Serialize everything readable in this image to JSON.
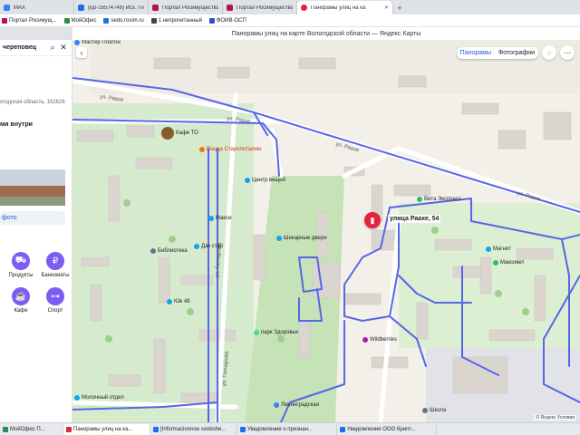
{
  "tabs": [
    {
      "label": "MAX",
      "color": "#3b82f6"
    },
    {
      "label": "(Бр-16574749) Исх. Письм",
      "color": "#1f6feb"
    },
    {
      "label": "Портал Росимущества",
      "color": "#b3125b"
    },
    {
      "label": "Портал Росимущества",
      "color": "#b3125b"
    },
    {
      "label": "Панорамы улиц на ка",
      "color": "#e5243b"
    }
  ],
  "new_tab": "+",
  "bookmarks": [
    {
      "label": "Портал Росимущ...",
      "color": "#b3125b"
    },
    {
      "label": "МойОфис",
      "color": "#2a8f4a"
    },
    {
      "label": "sedo.rosim.ru",
      "color": "#1f6feb"
    },
    {
      "label": "1 непрочитанный",
      "color": "#444"
    },
    {
      "label": "ФОИВ-ОСП",
      "color": "#2456c4"
    }
  ],
  "page_title": "Панорамы улиц на карте Вологодской области — Яндекс Карты",
  "panel": {
    "search_text": "череповец",
    "address": "огодская область, 162626",
    "inside_label": "ми внутри",
    "photo_link": "фото",
    "categories": [
      {
        "icon": "cart-icon",
        "label": "Продукты",
        "glyph": "⛟"
      },
      {
        "icon": "ruble-icon",
        "label": "Банкоматы",
        "glyph": "₽"
      },
      {
        "icon": "cafe-icon",
        "label": "Кафе",
        "glyph": "☕"
      },
      {
        "icon": "gym-icon",
        "label": "Спорт",
        "glyph": "⊶"
      }
    ]
  },
  "map": {
    "controls": {
      "panoramas": "Панорамы",
      "photos": "Фотографии"
    },
    "pin_label": "улица Раахе, 54",
    "streets": {
      "raahe1": "ул. Раахе",
      "raahe2": "ул. Раахе",
      "raahe3": "ул. Раахе",
      "raahe4": "ул. Раахе",
      "goncharova": "ул. Гончарова",
      "sovetsky": "ул. Гончарова"
    },
    "pois": {
      "master": "Мастер Платон",
      "cafe": "Кафе ТО",
      "pizza": "Пицца Старопоталию",
      "maxi": "Макси",
      "dent": "Дак стар",
      "bib": "Библиотека",
      "sale": "Шикарные двери",
      "vita": "Вита Экспресс",
      "magnit": "Магнит",
      "mobil": "Максивет",
      "wildberries": "Wildberries",
      "park": "парк Здоровья",
      "leningrad": "Ленинградская",
      "molo": "Молочный отдел",
      "yuv": "Юв 48",
      "school": "Школа",
      "sport": "Центр вещей"
    },
    "copyright": "© Яндекс Условия"
  },
  "taskbar": [
    {
      "label": "МойОфис П...",
      "color": "#2a8f4a",
      "active": false
    },
    {
      "label": "Панорамы улиц на ка...",
      "color": "#e5243b",
      "active": true
    },
    {
      "label": "[Informacionnoe soobshe...",
      "color": "#1f6feb",
      "active": false
    },
    {
      "label": "Уведомление о признан...",
      "color": "#1f6feb",
      "active": false
    },
    {
      "label": "Уведомление ООО Крипт...",
      "color": "#1f6feb",
      "active": false
    }
  ]
}
